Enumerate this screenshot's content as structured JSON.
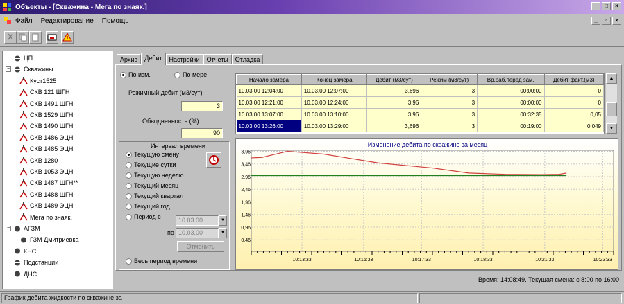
{
  "window": {
    "title": "Объекты - [Скважина - Мега по знаяк.]"
  },
  "menu": {
    "items": [
      "Файл",
      "Редактирование",
      "Помощь"
    ]
  },
  "tree": {
    "items": [
      {
        "label": "ЦП",
        "indent": 0
      },
      {
        "label": "Скважины",
        "indent": 0
      },
      {
        "label": "Куст1525",
        "indent": 1
      },
      {
        "label": "СКВ 121 ШГН",
        "indent": 1
      },
      {
        "label": "СКВ 1491 ШГН",
        "indent": 1
      },
      {
        "label": "СКВ 1529 ШГН",
        "indent": 1
      },
      {
        "label": "СКВ 1490 ШГН",
        "indent": 1
      },
      {
        "label": "СКВ 1486 ЭЦН",
        "indent": 1
      },
      {
        "label": "СКВ 1485 ЭЦН",
        "indent": 1
      },
      {
        "label": "СКВ 1280",
        "indent": 1
      },
      {
        "label": "СКВ 1053 ЭЦН",
        "indent": 1
      },
      {
        "label": "СКВ 1487 ШГН**",
        "indent": 1
      },
      {
        "label": "СКВ 1488 ШГН",
        "indent": 1
      },
      {
        "label": "СКВ 1489 ЭЦН",
        "indent": 1
      },
      {
        "label": "Мега по знаяк.",
        "indent": 1
      },
      {
        "label": "АГЗМ",
        "indent": 0
      },
      {
        "label": "ГЗМ Дмитриевка",
        "indent": 1
      },
      {
        "label": "КНС",
        "indent": 0
      },
      {
        "label": "Подстанции",
        "indent": 0
      },
      {
        "label": "ДНС",
        "indent": 0
      }
    ]
  },
  "tabs": [
    "Архив",
    "Дебит",
    "Настройки",
    "Отчеты",
    "Отладка"
  ],
  "left_panel": {
    "radio_by_meas": "По изм.",
    "radio_by_time": "По мере",
    "mode_label": "Режимный дебит (м3/сут)",
    "mode_value": "3",
    "water_label": "Обводненность (%)",
    "water_value": "90",
    "interval_title": "Интервал времени",
    "intervals": [
      "Текущую смену",
      "Текущие сутки",
      "Текущую неделю",
      "Текущий месяц",
      "Текущий квартал",
      "Текущий год",
      "Период с"
    ],
    "period_to_label": "по",
    "period_from": "10.03.00",
    "period_to": "10.03.00",
    "apply_label": "Отменить",
    "all_time": "Весь период времени"
  },
  "grid": {
    "columns": [
      "Начало замера",
      "Конец замера",
      "Дебит (м3/сут)",
      "Режим (м3/сут)",
      "Вр.раб.перед зам.",
      "Дебит факт.(м3)"
    ],
    "rows": [
      [
        "10.03.00 12:04:00",
        "10.03.00 12:07:00",
        "3,696",
        "3",
        "00:00:00",
        "0"
      ],
      [
        "10.03.00 12:21:00",
        "10.03.00 12:24:00",
        "3,96",
        "3",
        "00:00:00",
        "0"
      ],
      [
        "10.03.00 13:07:00",
        "10.03.00 13:10:00",
        "3,96",
        "3",
        "00:32:35",
        "0,05"
      ],
      [
        "10.03.00 13:26:00",
        "10.03.00 13:29:00",
        "3,696",
        "3",
        "00:19:00",
        "0,049"
      ]
    ]
  },
  "chart_data": {
    "type": "line",
    "title": "Изменение дебита по скважине за месяц",
    "xlabel": "",
    "ylabel": "",
    "x_ticks": [
      "10:13:33",
      "10:16:33",
      "10:17:33",
      "10:18:33",
      "10:21:33",
      "10:23:33"
    ],
    "ylim": [
      0,
      4
    ],
    "y_ticks": [
      "3,96",
      "3,46",
      "2,96",
      "2,46",
      "1,96",
      "1,46",
      "0,96",
      "0,46"
    ],
    "y_tick_values": [
      3.96,
      3.46,
      2.96,
      2.46,
      1.96,
      1.46,
      0.96,
      0.46
    ],
    "series": [
      {
        "values_x": [
          0,
          0.03,
          0.1,
          0.2,
          0.35,
          0.5,
          0.6,
          0.7,
          0.8,
          0.85,
          0.87
        ],
        "values": [
          3.7,
          3.72,
          3.96,
          3.85,
          3.5,
          3.3,
          3.1,
          3.05,
          3.04,
          3.05,
          3.1
        ],
        "color": "#d04040"
      },
      {
        "values_x": [
          0,
          0.87
        ],
        "values": [
          3.0,
          3.0
        ],
        "color": "#208020"
      }
    ],
    "grid": true
  },
  "status": {
    "time_text": "Время: 14:08:49. Текущая смена: с 8:00 по 16:00",
    "bottom_text": "График дебита жидкости по скважине за"
  }
}
